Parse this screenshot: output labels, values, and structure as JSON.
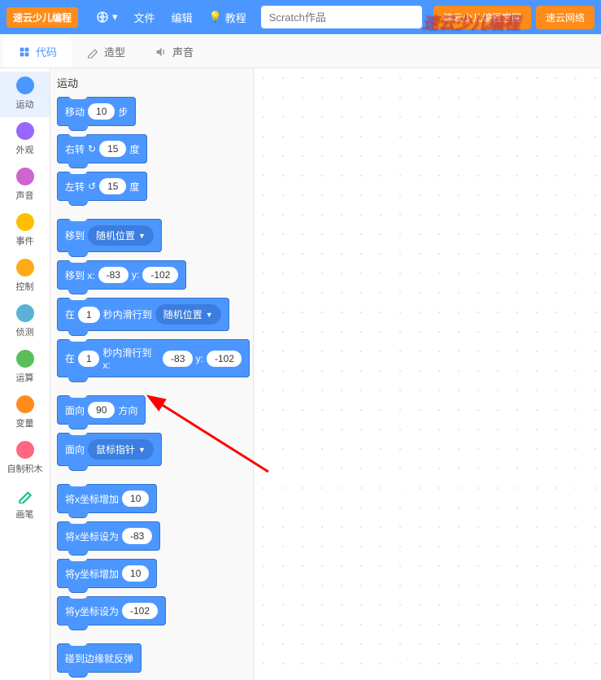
{
  "header": {
    "logo": "速云少儿编程",
    "menu_file": "文件",
    "menu_edit": "编辑",
    "menu_tutorial": "教程",
    "title_placeholder": "Scratch作品",
    "btn_official": "速云少儿编程官网",
    "btn_network": "速云网络",
    "watermark": "速云少儿编程"
  },
  "tabs": {
    "code": "代码",
    "costumes": "造型",
    "sounds": "声音"
  },
  "categories": [
    {
      "label": "运动",
      "color": "#4c97ff",
      "active": true
    },
    {
      "label": "外观",
      "color": "#9966ff"
    },
    {
      "label": "声音",
      "color": "#cf63cf"
    },
    {
      "label": "事件",
      "color": "#ffbf00"
    },
    {
      "label": "控制",
      "color": "#ffab19"
    },
    {
      "label": "侦测",
      "color": "#5cb1d6"
    },
    {
      "label": "运算",
      "color": "#59c059"
    },
    {
      "label": "变量",
      "color": "#ff8c1a"
    },
    {
      "label": "自制积木",
      "color": "#ff6680"
    },
    {
      "label": "画笔",
      "color": "#0fbd8c",
      "pen": true
    }
  ],
  "palette": {
    "header": "运动",
    "blocks": {
      "move_label1": "移动",
      "move_val": "10",
      "move_label2": "步",
      "turnr_label1": "右转",
      "turnr_val": "15",
      "turnr_label2": "度",
      "turnl_label1": "左转",
      "turnl_val": "15",
      "turnl_label2": "度",
      "goto_label": "移到",
      "goto_opt": "随机位置",
      "gotoxy_label1": "移到 x:",
      "gotoxy_x": "-83",
      "gotoxy_label2": "y:",
      "gotoxy_y": "-102",
      "glide_label1": "在",
      "glide_secs": "1",
      "glide_label2": "秒内滑行到",
      "glide_opt": "随机位置",
      "glidexy_label1": "在",
      "glidexy_secs": "1",
      "glidexy_label2": "秒内滑行到 x:",
      "glidexy_x": "-83",
      "glidexy_label3": "y:",
      "glidexy_y": "-102",
      "point_label1": "面向",
      "point_val": "90",
      "point_label2": "方向",
      "pointto_label": "面向",
      "pointto_opt": "鼠标指针",
      "changex_label": "将x坐标增加",
      "changex_val": "10",
      "setx_label": "将x坐标设为",
      "setx_val": "-83",
      "changey_label": "将y坐标增加",
      "changey_val": "10",
      "sety_label": "将y坐标设为",
      "sety_val": "-102",
      "bounce_label": "碰到边缘就反弹"
    }
  }
}
